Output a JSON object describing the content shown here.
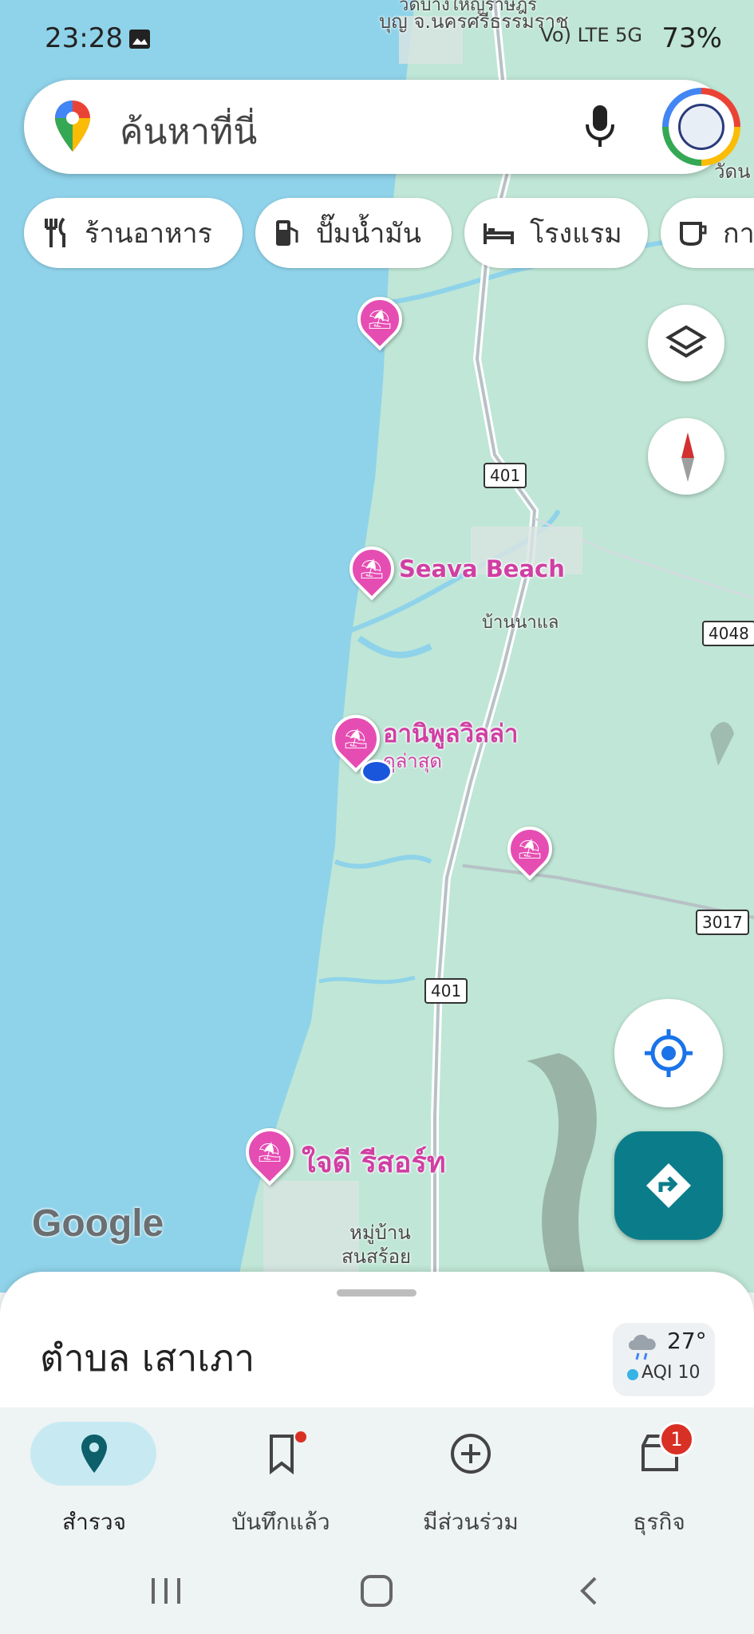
{
  "status_bar": {
    "time": "23:28",
    "battery": "73%",
    "signal": "Vo) LTE 5G",
    "icons": [
      "image-icon",
      "mute-icon",
      "location-icon",
      "signal-icon",
      "battery-icon"
    ]
  },
  "search": {
    "placeholder": "ค้นหาที่นี่"
  },
  "chips": [
    {
      "label": "ร้านอาหาร",
      "icon": "restaurant-icon"
    },
    {
      "label": "ปั๊มน้ำมัน",
      "icon": "gas-station-icon"
    },
    {
      "label": "โรงแรม",
      "icon": "hotel-icon"
    },
    {
      "label": "กา",
      "icon": "coffee-icon"
    }
  ],
  "map": {
    "labels": {
      "top_temple": "วัดบางใหญ่ราษฎร์",
      "top_temple2": "บุญ จ.นครศรีธรรมราช",
      "temple_right": "วัดน",
      "seava": "Seava Beach",
      "ban_na_lae": "บ้านนาแล",
      "anipool": "อานิพูลวิลล่า",
      "anipool_sub": "ดูล่าสุด",
      "jaidee": "ใจดี รีสอร์ท",
      "village1": "หมู่บ้าน",
      "village2": "สนสร้อย",
      "google": "Google"
    },
    "shields": {
      "r401a": "401",
      "r401b": "401",
      "r4048": "4048",
      "r3017": "3017"
    },
    "colors": {
      "sea": "#8fd3ea",
      "land": "#bfe6d6",
      "pin": "#e64db3",
      "accent": "#0b7d8a"
    }
  },
  "sheet": {
    "place": "ตำบล เสาเภา",
    "temp": "27°",
    "aqi": "AQI 10"
  },
  "nav": [
    {
      "label": "สำรวจ",
      "icon": "explore-pin-icon",
      "active": true
    },
    {
      "label": "บันทึกแล้ว",
      "icon": "bookmark-icon",
      "active": false
    },
    {
      "label": "มีส่วนร่วม",
      "icon": "add-circle-icon",
      "active": false
    },
    {
      "label": "ธุรกิจ",
      "icon": "store-icon",
      "active": false,
      "badge": "1"
    }
  ]
}
